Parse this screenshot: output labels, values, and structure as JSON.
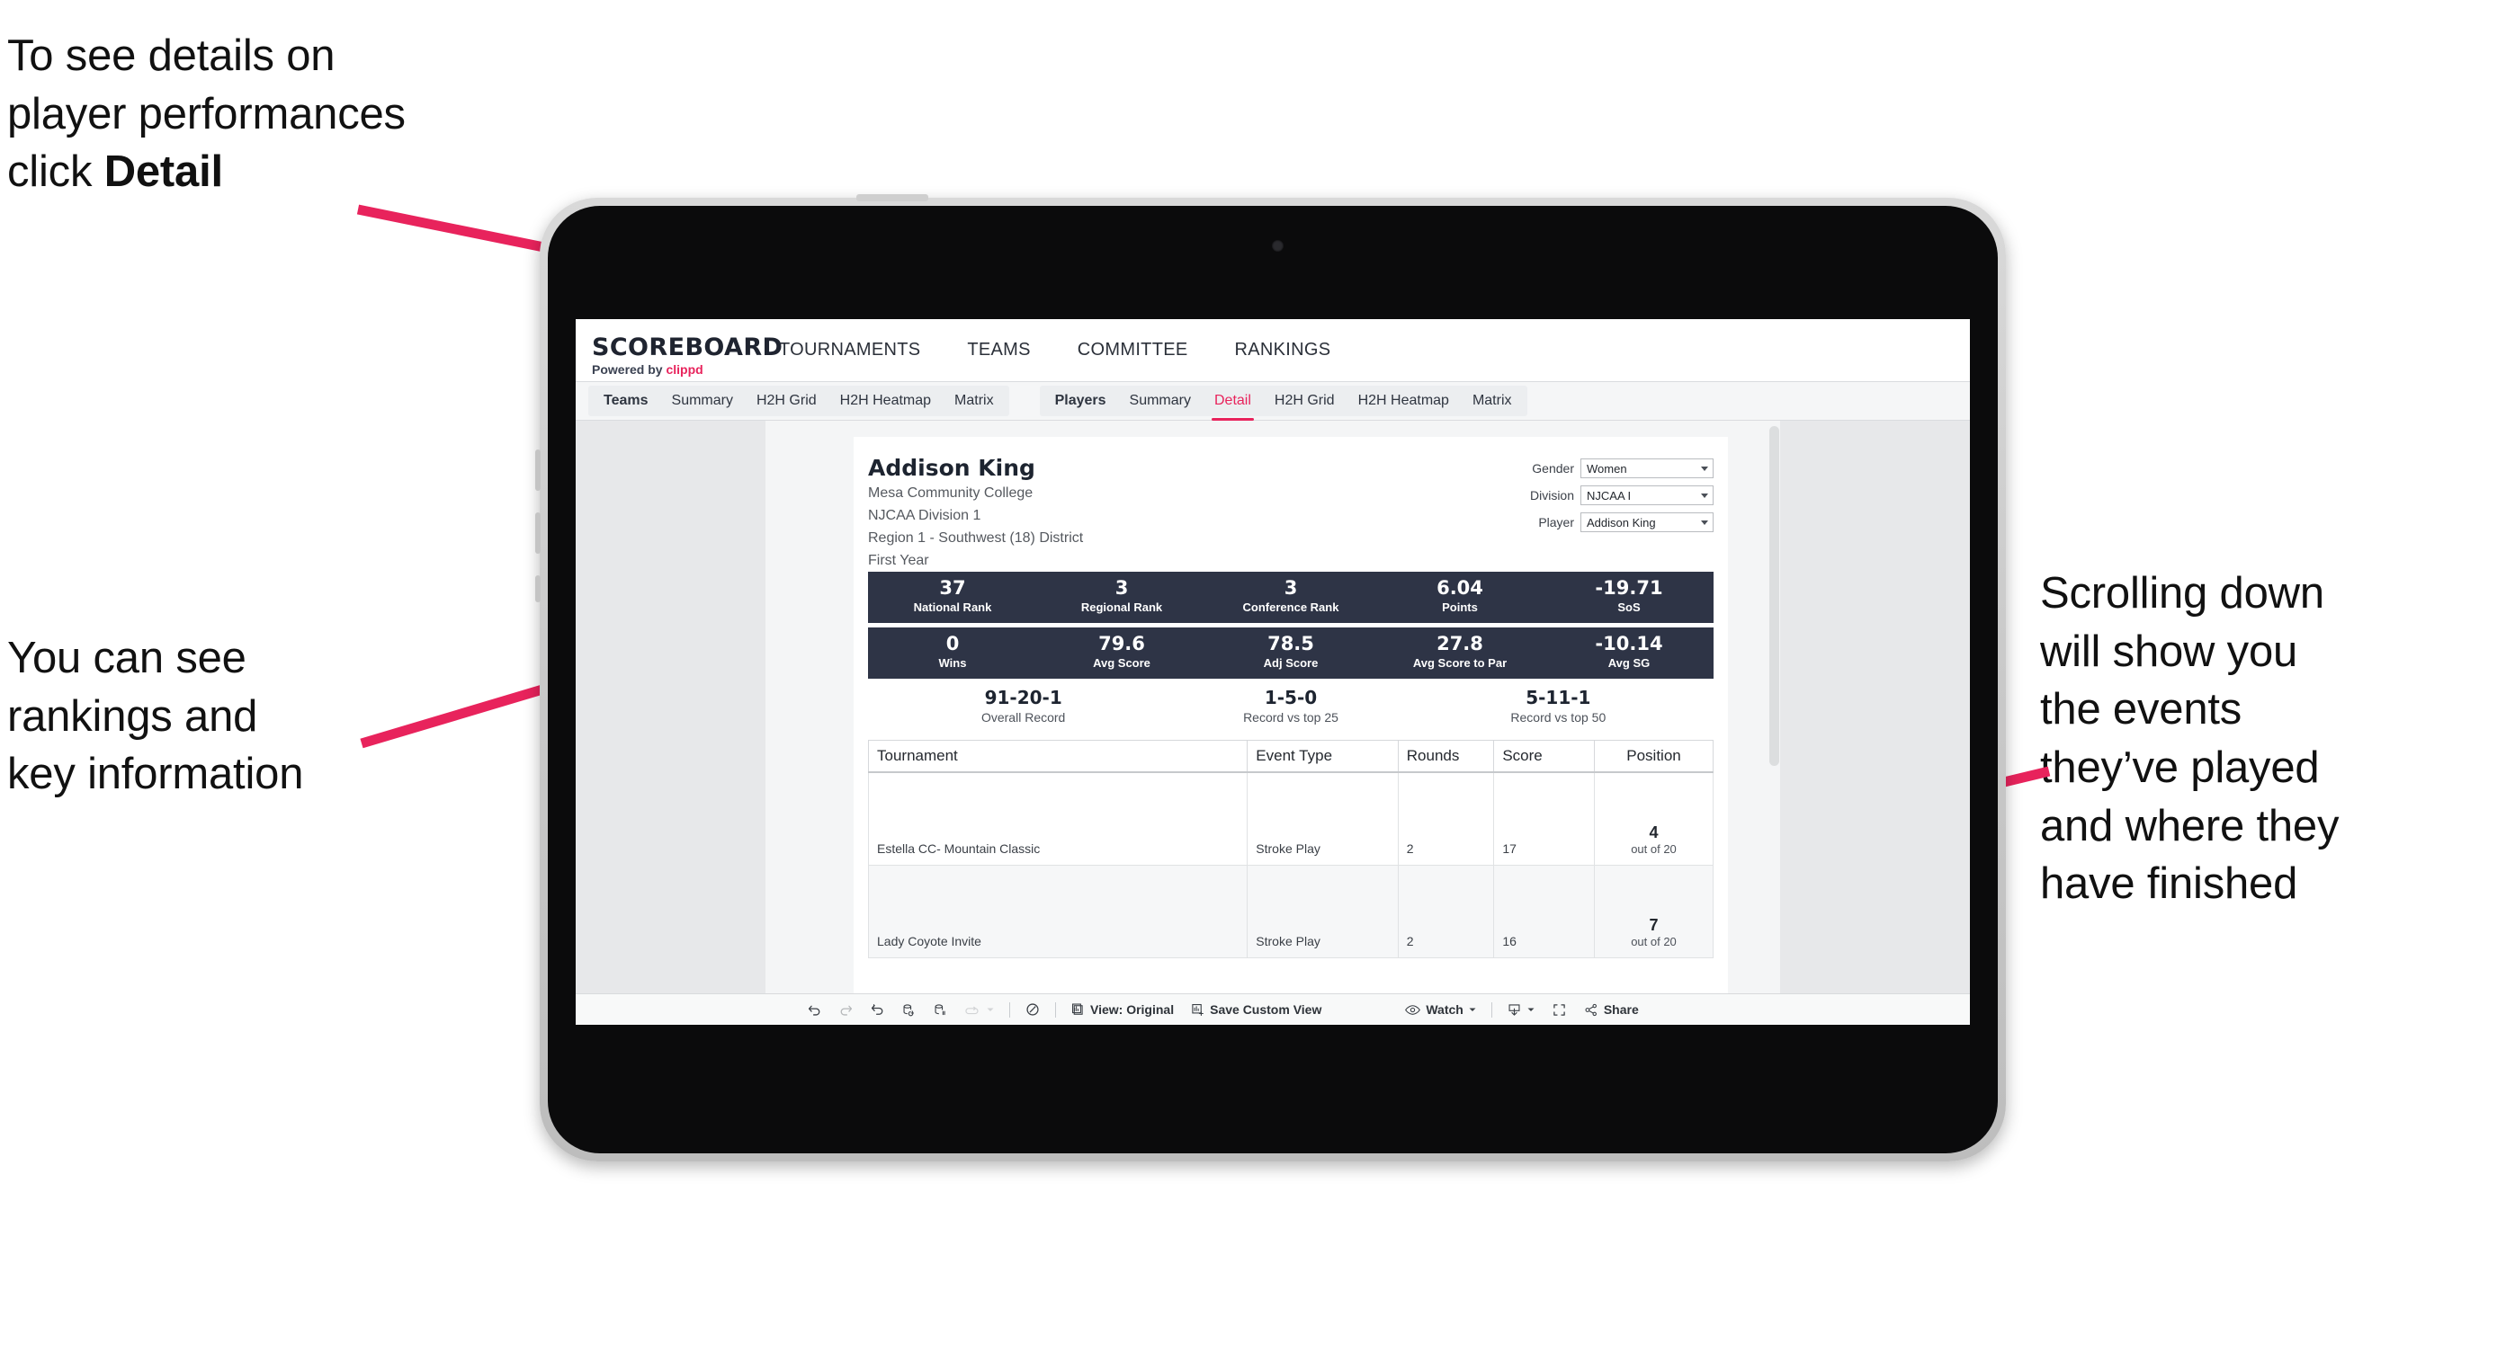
{
  "annotations": {
    "top_left": "To see details on\nplayer performances\nclick ",
    "top_left_bold": "Detail",
    "mid_left": "You can see\nrankings and\nkey information",
    "right": "Scrolling down\nwill show you\nthe events\nthey’ve played\nand where they\nhave finished",
    "arrow_color": "#e8235c"
  },
  "app": {
    "brand_title": "SCOREBOARD",
    "brand_powered": "Powered by ",
    "brand_name": "clippd",
    "top_nav": [
      {
        "label": "TOURNAMENTS"
      },
      {
        "label": "TEAMS"
      },
      {
        "label": "COMMITTEE"
      },
      {
        "label": "RANKINGS"
      }
    ],
    "teams_tabs": [
      {
        "label": "Teams",
        "head": true,
        "active": false
      },
      {
        "label": "Summary",
        "head": false,
        "active": false
      },
      {
        "label": "H2H Grid",
        "head": false,
        "active": false
      },
      {
        "label": "H2H Heatmap",
        "head": false,
        "active": false
      },
      {
        "label": "Matrix",
        "head": false,
        "active": false
      }
    ],
    "players_tabs": [
      {
        "label": "Players",
        "head": true,
        "active": false
      },
      {
        "label": "Summary",
        "head": false,
        "active": false
      },
      {
        "label": "Detail",
        "head": false,
        "active": true
      },
      {
        "label": "H2H Grid",
        "head": false,
        "active": false
      },
      {
        "label": "H2H Heatmap",
        "head": false,
        "active": false
      },
      {
        "label": "Matrix",
        "head": false,
        "active": false
      }
    ],
    "accent_color": "#e8235c",
    "stat_card_color": "#2e3446"
  },
  "player": {
    "name": "Addison King",
    "school": "Mesa Community College",
    "division": "NJCAA Division 1",
    "region": "Region 1 - Southwest (18) District",
    "year": "First Year"
  },
  "filters": [
    {
      "label": "Gender",
      "value": "Women"
    },
    {
      "label": "Division",
      "value": "NJCAA I"
    },
    {
      "label": "Player",
      "value": "Addison King"
    }
  ],
  "stats_row_1": [
    {
      "value": "37",
      "label": "National Rank"
    },
    {
      "value": "3",
      "label": "Regional Rank"
    },
    {
      "value": "3",
      "label": "Conference Rank"
    },
    {
      "value": "6.04",
      "label": "Points"
    },
    {
      "value": "-19.71",
      "label": "SoS"
    }
  ],
  "stats_row_2": [
    {
      "value": "0",
      "label": "Wins"
    },
    {
      "value": "79.6",
      "label": "Avg Score"
    },
    {
      "value": "78.5",
      "label": "Adj Score"
    },
    {
      "value": "27.8",
      "label": "Avg Score to Par"
    },
    {
      "value": "-10.14",
      "label": "Avg SG"
    }
  ],
  "records": [
    {
      "value": "91-20-1",
      "label": "Overall Record"
    },
    {
      "value": "1-5-0",
      "label": "Record vs top 25"
    },
    {
      "value": "5-11-1",
      "label": "Record vs top 50"
    }
  ],
  "events_table": {
    "columns": [
      "Tournament",
      "Event Type",
      "Rounds",
      "Score",
      "Position"
    ],
    "rows": [
      {
        "tournament": "Estella CC- Mountain Classic",
        "event_type": "Stroke Play",
        "rounds": "2",
        "score": "17",
        "position": "4",
        "position_note": "out of 20"
      },
      {
        "tournament": "Lady Coyote Invite",
        "event_type": "Stroke Play",
        "rounds": "2",
        "score": "16",
        "position": "7",
        "position_note": "out of 20"
      }
    ]
  },
  "toolbar": {
    "undo": "undo-icon",
    "redo": "redo-icon",
    "revert": "revert-icon",
    "refresh": "refresh-icon",
    "pause": "pause-icon",
    "loop": "loop-icon",
    "device": "device-icon",
    "view_label": "View: Original",
    "save_view_label": "Save Custom View",
    "watch_label": "Watch",
    "download": "download-icon",
    "fullscreen": "fullscreen-icon",
    "share_label": "Share"
  }
}
